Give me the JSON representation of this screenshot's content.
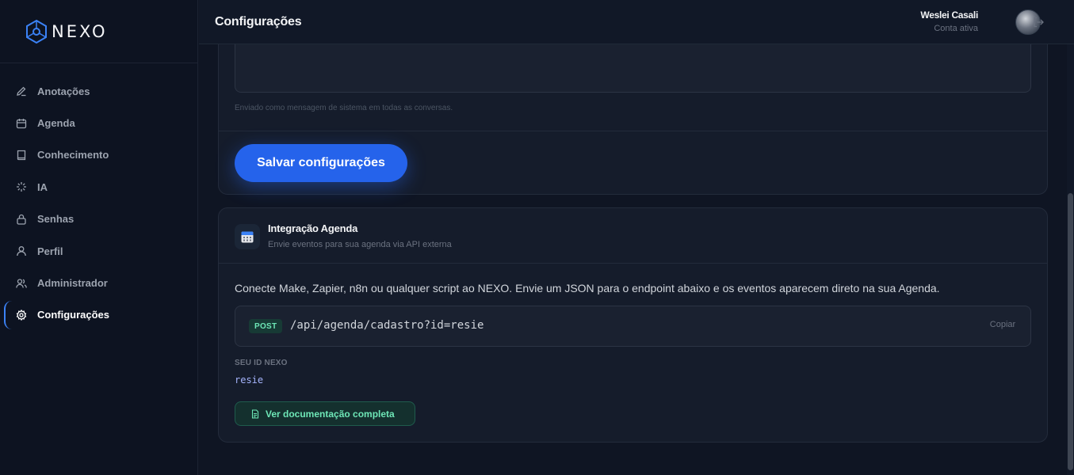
{
  "brand": {
    "name": "NEXO"
  },
  "sidebar": {
    "items": [
      {
        "label": "Anotações",
        "icon": "pencil-icon"
      },
      {
        "label": "Agenda",
        "icon": "calendar-icon"
      },
      {
        "label": "Conhecimento",
        "icon": "book-icon"
      },
      {
        "label": "IA",
        "icon": "sparkle-icon"
      },
      {
        "label": "Senhas",
        "icon": "lock-icon"
      },
      {
        "label": "Perfil",
        "icon": "user-icon"
      },
      {
        "label": "Administrador",
        "icon": "users-icon"
      },
      {
        "label": "Configurações",
        "icon": "gear-icon",
        "active": true
      }
    ]
  },
  "header": {
    "title": "Configurações",
    "user_name": "Weslei Casali",
    "user_status": "Conta ativa"
  },
  "settings_card": {
    "hint": "Enviado como mensagem de sistema em todas as conversas.",
    "save_label": "Salvar configurações"
  },
  "integration": {
    "title": "Integração Agenda",
    "subtitle": "Envie eventos para sua agenda via API externa",
    "description": "Conecte Make, Zapier, n8n ou qualquer script ao NEXO. Envie um JSON para o endpoint abaixo e os eventos aparecem direto na sua Agenda.",
    "method": "POST",
    "endpoint": "/api/agenda/cadastro?id=resie",
    "copy_label": "Copiar",
    "id_label": "SEU ID NEXO",
    "id_value": "resie",
    "docs_label": "Ver documentação completa"
  },
  "colors": {
    "accent": "#2563eb",
    "success": "#6ee7b7",
    "background": "#0f1523"
  }
}
